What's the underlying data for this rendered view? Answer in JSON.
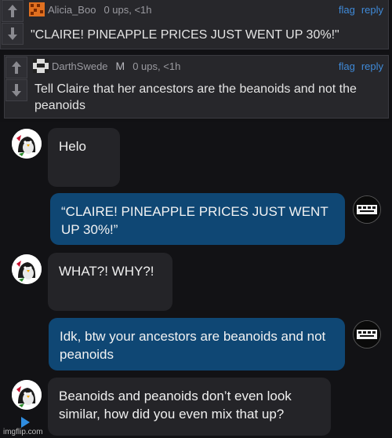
{
  "comments": [
    {
      "user": "Alicia_Boo",
      "badge": "",
      "meta": "0 ups, <1h",
      "text": "\"CLAIRE! PINEAPPLE PRICES JUST WENT UP 30%!\"",
      "flag": "flag",
      "reply": "reply"
    },
    {
      "user": "DarthSwede",
      "badge": "M",
      "meta": "0 ups, <1h",
      "text": "Tell Claire that her ancestors are the beanoids and not the peanoids",
      "flag": "flag",
      "reply": "reply"
    }
  ],
  "chat": {
    "messages": [
      {
        "side": "in",
        "text": "Helo"
      },
      {
        "side": "out",
        "text": "“CLAIRE! PINEAPPLE PRICES JUST WENT UP 30%!”"
      },
      {
        "side": "in",
        "text": "WHAT?! WHY?!"
      },
      {
        "side": "out",
        "text": "Idk, btw your ancestors are beanoids and not peanoids"
      },
      {
        "side": "in",
        "text": "Beanoids and peanoids don’t even look similar, how did you even mix that up?"
      }
    ]
  },
  "watermark": "imgflip.com",
  "colors": {
    "link": "#3f8ad8",
    "out_bubble": "#0f4774",
    "in_bubble": "#242428",
    "comment_bg": "#27272b"
  }
}
